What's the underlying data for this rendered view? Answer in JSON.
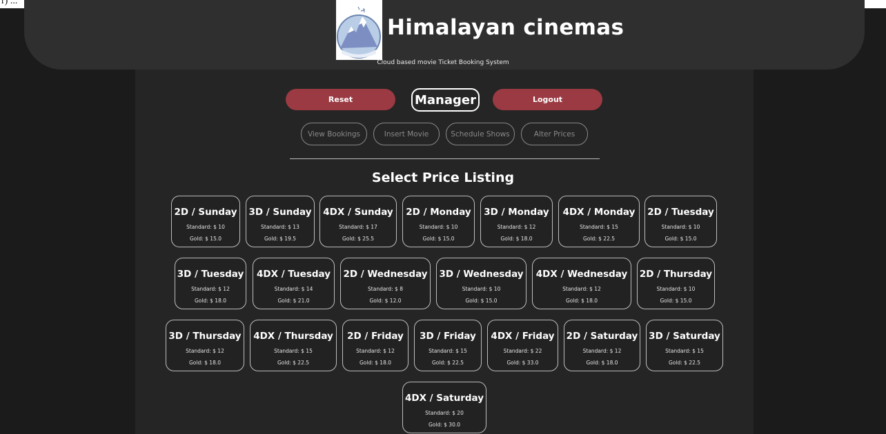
{
  "header": {
    "brand": "Himalayan cinemas",
    "tagline": "Cloud based movie Ticket Booking System",
    "top_fragment": "r) ..."
  },
  "actions": {
    "reset_label": "Reset",
    "role_label": "Manager",
    "logout_label": "Logout"
  },
  "nav": {
    "items": [
      "View Bookings",
      "Insert Movie",
      "Schedule Shows",
      "Alter Prices"
    ]
  },
  "section_title": "Select Price Listing",
  "price_cards": [
    {
      "title": "2D / Sunday",
      "standard": "Standard: $ 10",
      "gold": "Gold: $ 15.0"
    },
    {
      "title": "3D / Sunday",
      "standard": "Standard: $ 13",
      "gold": "Gold: $ 19.5"
    },
    {
      "title": "4DX / Sunday",
      "standard": "Standard: $ 17",
      "gold": "Gold: $ 25.5"
    },
    {
      "title": "2D / Monday",
      "standard": "Standard: $ 10",
      "gold": "Gold: $ 15.0"
    },
    {
      "title": "3D / Monday",
      "standard": "Standard: $ 12",
      "gold": "Gold: $ 18.0"
    },
    {
      "title": "4DX / Monday",
      "standard": "Standard: $ 15",
      "gold": "Gold: $ 22.5"
    },
    {
      "title": "2D / Tuesday",
      "standard": "Standard: $ 10",
      "gold": "Gold: $ 15.0"
    },
    {
      "title": "3D / Tuesday",
      "standard": "Standard: $ 12",
      "gold": "Gold: $ 18.0"
    },
    {
      "title": "4DX / Tuesday",
      "standard": "Standard: $ 14",
      "gold": "Gold: $ 21.0"
    },
    {
      "title": "2D / Wednesday",
      "standard": "Standard: $ 8",
      "gold": "Gold: $ 12.0"
    },
    {
      "title": "3D / Wednesday",
      "standard": "Standard: $ 10",
      "gold": "Gold: $ 15.0"
    },
    {
      "title": "4DX / Wednesday",
      "standard": "Standard: $ 12",
      "gold": "Gold: $ 18.0"
    },
    {
      "title": "2D / Thursday",
      "standard": "Standard: $ 10",
      "gold": "Gold: $ 15.0"
    },
    {
      "title": "3D / Thursday",
      "standard": "Standard: $ 12",
      "gold": "Gold: $ 18.0"
    },
    {
      "title": "4DX / Thursday",
      "standard": "Standard: $ 15",
      "gold": "Gold: $ 22.5"
    },
    {
      "title": "2D / Friday",
      "standard": "Standard: $ 12",
      "gold": "Gold: $ 18.0"
    },
    {
      "title": "3D / Friday",
      "standard": "Standard: $ 15",
      "gold": "Gold: $ 22.5"
    },
    {
      "title": "4DX / Friday",
      "standard": "Standard: $ 22",
      "gold": "Gold: $ 33.0"
    },
    {
      "title": "2D / Saturday",
      "standard": "Standard: $ 12",
      "gold": "Gold: $ 18.0"
    },
    {
      "title": "3D / Saturday",
      "standard": "Standard: $ 15",
      "gold": "Gold: $ 22.5"
    },
    {
      "title": "4DX / Saturday",
      "standard": "Standard: $ 20",
      "gold": "Gold: $ 30.0"
    }
  ],
  "colors": {
    "accent_red": "#9b3a42",
    "panel": "#252525",
    "header": "#2f2f2f",
    "background": "#1b1b1b"
  },
  "icons": {
    "logo": "mountain-logo-icon"
  }
}
